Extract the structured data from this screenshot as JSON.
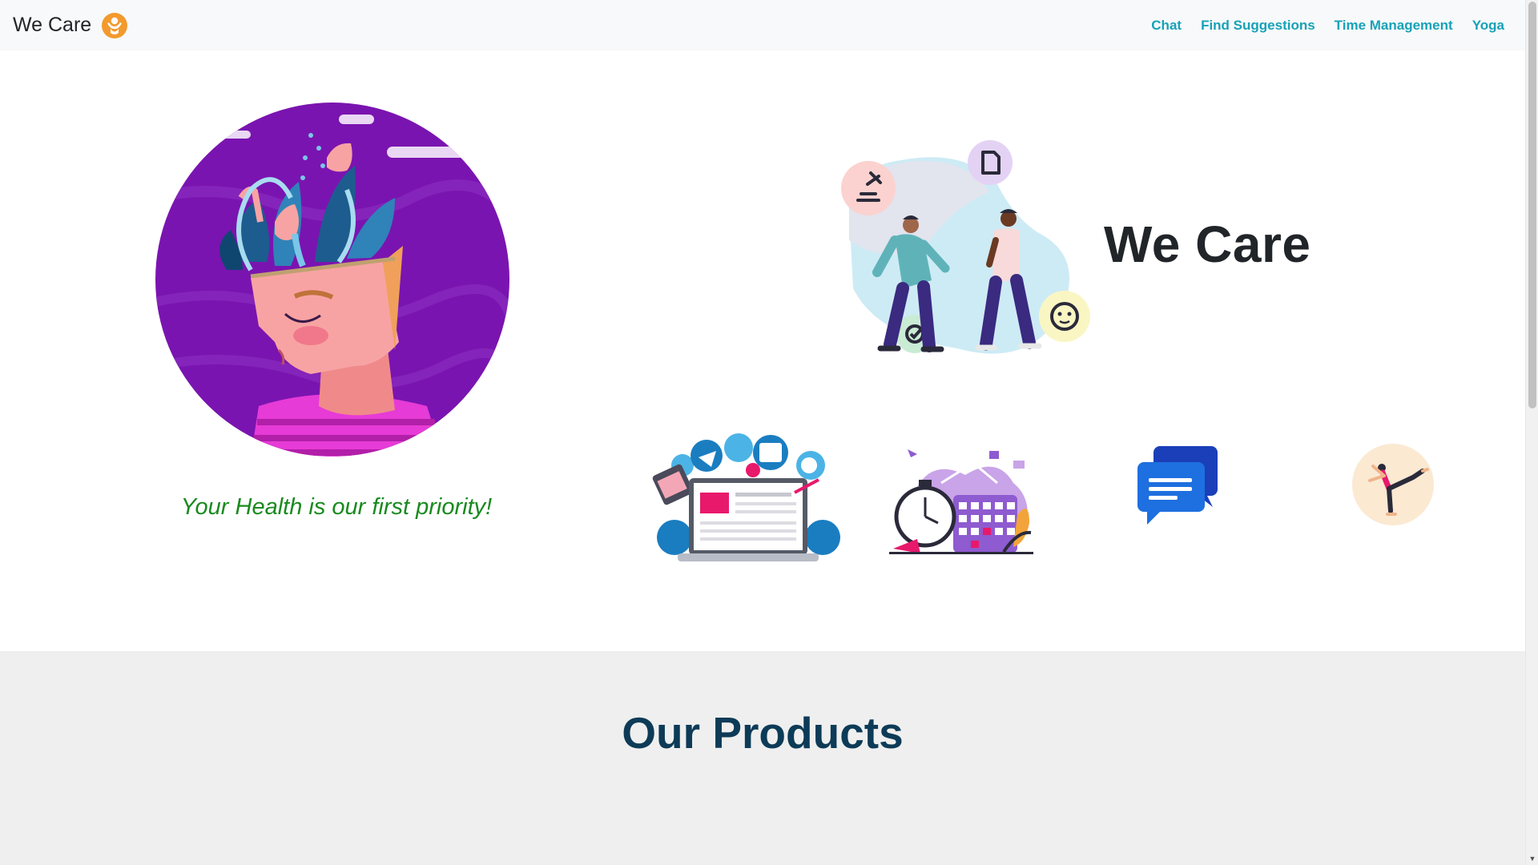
{
  "navbar": {
    "brand": "We Care",
    "links": [
      "Chat",
      "Find Suggestions",
      "Time Management",
      "Yoga"
    ]
  },
  "hero": {
    "title": "We Care",
    "tagline": "Your Health is our first priority!"
  },
  "products": {
    "title": "Our Products"
  },
  "icons": {
    "brand": "wecare-logo-icon",
    "head": "mind-illustration",
    "team": "team-discussion-illustration",
    "feature_1": "laptop-social-illustration",
    "feature_2": "time-management-illustration",
    "feature_3": "chat-bubbles-icon",
    "feature_4": "yoga-pose-icon"
  },
  "colors": {
    "nav_link": "#17a2b8",
    "tagline": "#198a1f",
    "products_title": "#0d3b57",
    "products_bg": "#efefef"
  }
}
